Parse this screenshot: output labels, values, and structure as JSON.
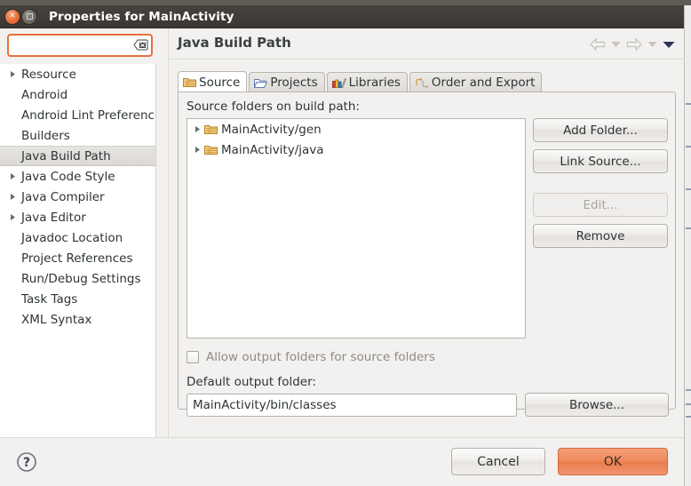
{
  "window": {
    "title": "Properties for MainActivity",
    "close_icon": "close-icon",
    "maximize_icon": "maximize-icon"
  },
  "sidebar": {
    "search": {
      "value": "",
      "placeholder": "",
      "clear_icon": "clear-icon"
    },
    "items": [
      {
        "label": "Resource",
        "expandable": true,
        "selected": false
      },
      {
        "label": "Android",
        "expandable": false,
        "selected": false
      },
      {
        "label": "Android Lint Preferences",
        "expandable": false,
        "selected": false
      },
      {
        "label": "Builders",
        "expandable": false,
        "selected": false
      },
      {
        "label": "Java Build Path",
        "expandable": false,
        "selected": true
      },
      {
        "label": "Java Code Style",
        "expandable": true,
        "selected": false
      },
      {
        "label": "Java Compiler",
        "expandable": true,
        "selected": false
      },
      {
        "label": "Java Editor",
        "expandable": true,
        "selected": false
      },
      {
        "label": "Javadoc Location",
        "expandable": false,
        "selected": false
      },
      {
        "label": "Project References",
        "expandable": false,
        "selected": false
      },
      {
        "label": "Run/Debug Settings",
        "expandable": false,
        "selected": false
      },
      {
        "label": "Task Tags",
        "expandable": false,
        "selected": false
      },
      {
        "label": "XML Syntax",
        "expandable": false,
        "selected": false
      }
    ],
    "scrollbar_color": "#e8703a"
  },
  "page": {
    "title": "Java Build Path",
    "nav": {
      "back_icon": "back-arrow-icon",
      "back_menu_icon": "chevron-down-icon",
      "forward_icon": "forward-arrow-icon",
      "forward_menu_icon": "chevron-down-icon",
      "view_menu_icon": "view-menu-icon"
    },
    "tabs": [
      {
        "label": "Source",
        "icon": "source-folder-icon",
        "active": true
      },
      {
        "label": "Projects",
        "icon": "projects-folder-icon",
        "active": false
      },
      {
        "label": "Libraries",
        "icon": "libraries-books-icon",
        "active": false
      },
      {
        "label": "Order and Export",
        "icon": "order-export-icon",
        "active": false
      }
    ],
    "source_tab": {
      "list_label": "Source folders on build path:",
      "entries": [
        {
          "label": "MainActivity/gen",
          "icon": "source-folder-icon",
          "expandable": true
        },
        {
          "label": "MainActivity/java",
          "icon": "source-folder-icon",
          "expandable": true
        }
      ],
      "buttons": [
        {
          "label": "Add Folder...",
          "enabled": true
        },
        {
          "label": "Link Source...",
          "enabled": true
        },
        {
          "label": "Edit...",
          "enabled": false
        },
        {
          "label": "Remove",
          "enabled": true
        }
      ],
      "allow_output_checkbox": {
        "label": "Allow output folders for source folders",
        "checked": false
      },
      "default_output_label": "Default output folder:",
      "default_output_value": "MainActivity/bin/classes",
      "browse_label": "Browse..."
    }
  },
  "footer": {
    "help_icon": "help-question-icon",
    "cancel_label": "Cancel",
    "ok_label": "OK",
    "ok_color": "#ea7c4c"
  }
}
